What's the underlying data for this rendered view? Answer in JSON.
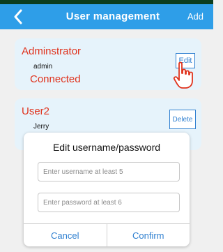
{
  "header": {
    "title": "User management",
    "add_label": "Add",
    "back_icon": "chevron-left-icon"
  },
  "users": [
    {
      "name": "Adminstrator",
      "username": "admin",
      "status": "Connected",
      "action_label": "Edit"
    },
    {
      "name": "User2",
      "username": "Jerry",
      "action_label": "Delete"
    }
  ],
  "dialog": {
    "title": "Edit  username/password",
    "username_placeholder": "Enter username at least 5",
    "password_placeholder": "Enter password at least 6",
    "cancel_label": "Cancel",
    "confirm_label": "Confirm"
  },
  "colors": {
    "header": "#2e9ee8",
    "accent": "#2e7fd0",
    "name_red": "#e0321c",
    "card_bg": "#e6f3fb"
  }
}
